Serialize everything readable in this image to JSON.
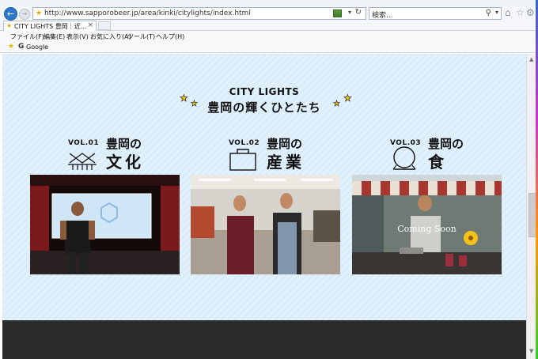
{
  "browser": {
    "url": "http://www.sapporobeer.jp/area/kinki/citylights/index.html",
    "search_placeholder": "検索...",
    "tab_title": "CITY LIGHTS 豊岡｜近...",
    "menu": [
      "ファイル(F)",
      "編集(E)",
      "表示(V)",
      "お気に入り(A)",
      "ツール(T)",
      "ヘルプ(H)"
    ],
    "favorites": [
      {
        "label": "Google"
      }
    ]
  },
  "page": {
    "heading_en": "CITY LIGHTS",
    "heading_ja": "豊岡の輝くひとたち",
    "cards": [
      {
        "vol": "VOL.01",
        "title1": "豊岡の",
        "title2": "文化",
        "icon": "gate-icon",
        "coming": ""
      },
      {
        "vol": "VOL.02",
        "title1": "豊岡の",
        "title2": "産業",
        "icon": "bag-icon",
        "coming": ""
      },
      {
        "vol": "VOL.03",
        "title1": "豊岡の",
        "title2": "食",
        "icon": "bowl-icon",
        "coming": "Coming Soon"
      }
    ]
  },
  "colors": {
    "accent": "#f5c400",
    "page_bg": "#dcedfa",
    "footer": "#2b2b2b"
  }
}
